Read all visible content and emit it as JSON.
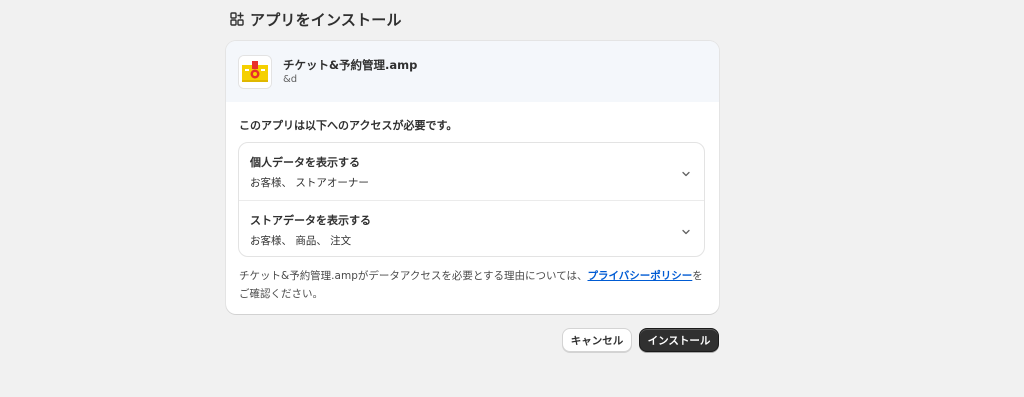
{
  "header": {
    "title": "アプリをインストール",
    "icon": "apps-icon"
  },
  "app": {
    "name": "チケット&予約管理.amp",
    "developer": "&d",
    "icon": "app-logo-icon"
  },
  "access": {
    "title": "このアプリは以下へのアクセスが必要です。",
    "permissions": [
      {
        "title": "個人データを表示する",
        "description": "お客様、 ストアオーナー",
        "icon": "chevron-down-icon"
      },
      {
        "title": "ストアデータを表示する",
        "description": "お客様、 商品、 注文",
        "icon": "chevron-down-icon"
      }
    ]
  },
  "note": {
    "text": "チケット&予約管理.ampがデータアクセスを必要とする理由については、",
    "link": "プライバシーポリシー",
    "suffix": "をご確認ください。"
  },
  "actions": {
    "cancel": "キャンセル",
    "install": "インストール"
  },
  "colors": {
    "background": "#f1f1f1",
    "card": "#ffffff",
    "app_row": "#f4f7fb",
    "primary_button": "#303030",
    "link": "#005bd3",
    "logo_yellow": "#f5d000",
    "logo_red": "#e8302a"
  }
}
